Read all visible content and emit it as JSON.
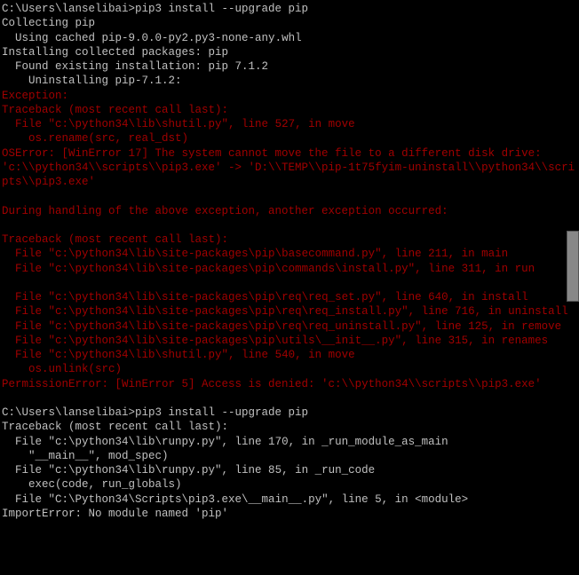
{
  "lines": [
    {
      "cls": "white",
      "t": "C:\\Users\\lanselibai>pip3 install --upgrade pip"
    },
    {
      "cls": "white",
      "t": "Collecting pip"
    },
    {
      "cls": "white",
      "t": "  Using cached pip-9.0.0-py2.py3-none-any.whl"
    },
    {
      "cls": "white",
      "t": "Installing collected packages: pip"
    },
    {
      "cls": "white",
      "t": "  Found existing installation: pip 7.1.2"
    },
    {
      "cls": "white",
      "t": "    Uninstalling pip-7.1.2:"
    },
    {
      "cls": "red",
      "t": "Exception:"
    },
    {
      "cls": "red",
      "t": "Traceback (most recent call last):"
    },
    {
      "cls": "red",
      "t": "  File \"c:\\python34\\lib\\shutil.py\", line 527, in move"
    },
    {
      "cls": "red",
      "t": "    os.rename(src, real_dst)"
    },
    {
      "cls": "red",
      "t": "OSError: [WinError 17] The system cannot move the file to a different disk drive: 'c:\\\\python34\\\\scripts\\\\pip3.exe' -> 'D:\\\\TEMP\\\\pip-1t75fyim-uninstall\\\\python34\\\\scripts\\\\pip3.exe'"
    },
    {
      "cls": "red",
      "t": ""
    },
    {
      "cls": "red",
      "t": "During handling of the above exception, another exception occurred:"
    },
    {
      "cls": "red",
      "t": ""
    },
    {
      "cls": "red",
      "t": "Traceback (most recent call last):"
    },
    {
      "cls": "red",
      "t": "  File \"c:\\python34\\lib\\site-packages\\pip\\basecommand.py\", line 211, in main"
    },
    {
      "cls": "red",
      "t": "  File \"c:\\python34\\lib\\site-packages\\pip\\commands\\install.py\", line 311, in run"
    },
    {
      "cls": "red",
      "t": ""
    },
    {
      "cls": "red",
      "t": "  File \"c:\\python34\\lib\\site-packages\\pip\\req\\req_set.py\", line 640, in install"
    },
    {
      "cls": "red",
      "t": "  File \"c:\\python34\\lib\\site-packages\\pip\\req\\req_install.py\", line 716, in uninstall"
    },
    {
      "cls": "red",
      "t": "  File \"c:\\python34\\lib\\site-packages\\pip\\req\\req_uninstall.py\", line 125, in remove"
    },
    {
      "cls": "red",
      "t": "  File \"c:\\python34\\lib\\site-packages\\pip\\utils\\__init__.py\", line 315, in renames"
    },
    {
      "cls": "red",
      "t": "  File \"c:\\python34\\lib\\shutil.py\", line 540, in move"
    },
    {
      "cls": "red",
      "t": "    os.unlink(src)"
    },
    {
      "cls": "red",
      "t": "PermissionError: [WinError 5] Access is denied: 'c:\\\\python34\\\\scripts\\\\pip3.exe'"
    },
    {
      "cls": "white",
      "t": ""
    },
    {
      "cls": "white",
      "t": "C:\\Users\\lanselibai>pip3 install --upgrade pip"
    },
    {
      "cls": "white",
      "t": "Traceback (most recent call last):"
    },
    {
      "cls": "white",
      "t": "  File \"c:\\python34\\lib\\runpy.py\", line 170, in _run_module_as_main"
    },
    {
      "cls": "white",
      "t": "    \"__main__\", mod_spec)"
    },
    {
      "cls": "white",
      "t": "  File \"c:\\python34\\lib\\runpy.py\", line 85, in _run_code"
    },
    {
      "cls": "white",
      "t": "    exec(code, run_globals)"
    },
    {
      "cls": "white",
      "t": "  File \"C:\\Python34\\Scripts\\pip3.exe\\__main__.py\", line 5, in <module>"
    },
    {
      "cls": "white",
      "t": "ImportError: No module named 'pip'"
    }
  ]
}
